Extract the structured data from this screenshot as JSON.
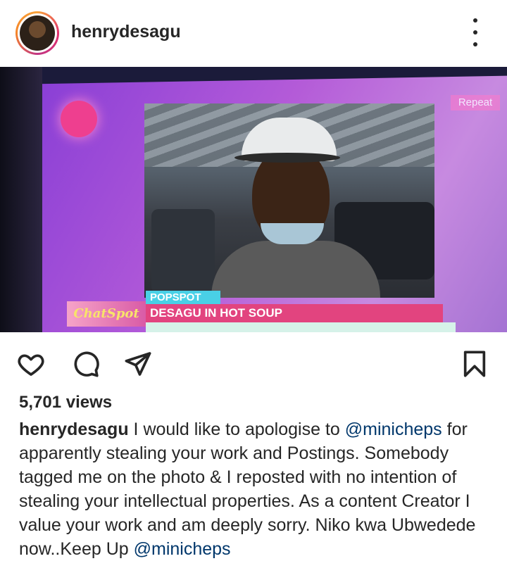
{
  "post": {
    "username": "henrydesagu",
    "views": "5,701 views",
    "caption": {
      "username": "henrydesagu",
      "text_1": " I would like to apologise to ",
      "mention_1": "@minicheps",
      "text_2": " for apparently  stealing your work and Postings. Somebody tagged me on the photo & I reposted with no intention of stealing  your intellectual properties. As a content Creator I value your work and am deeply sorry. Niko kwa Ubwedede now..Keep Up ",
      "mention_2": "@minicheps"
    }
  },
  "media": {
    "repeat_label": "Repeat",
    "chatspot_logo": "ChatSpot",
    "popspot_tag": "POPSPOT",
    "headline": "DESAGU IN HOT SOUP"
  },
  "icons": {
    "like": "heart-icon",
    "comment": "comment-icon",
    "share": "paper-plane-icon",
    "save": "bookmark-icon",
    "more": "more-vertical-icon"
  },
  "colors": {
    "text": "#262626",
    "mention": "#00376b",
    "headline_bar": "#e2447f",
    "popspot_bar": "#49d0e6"
  }
}
